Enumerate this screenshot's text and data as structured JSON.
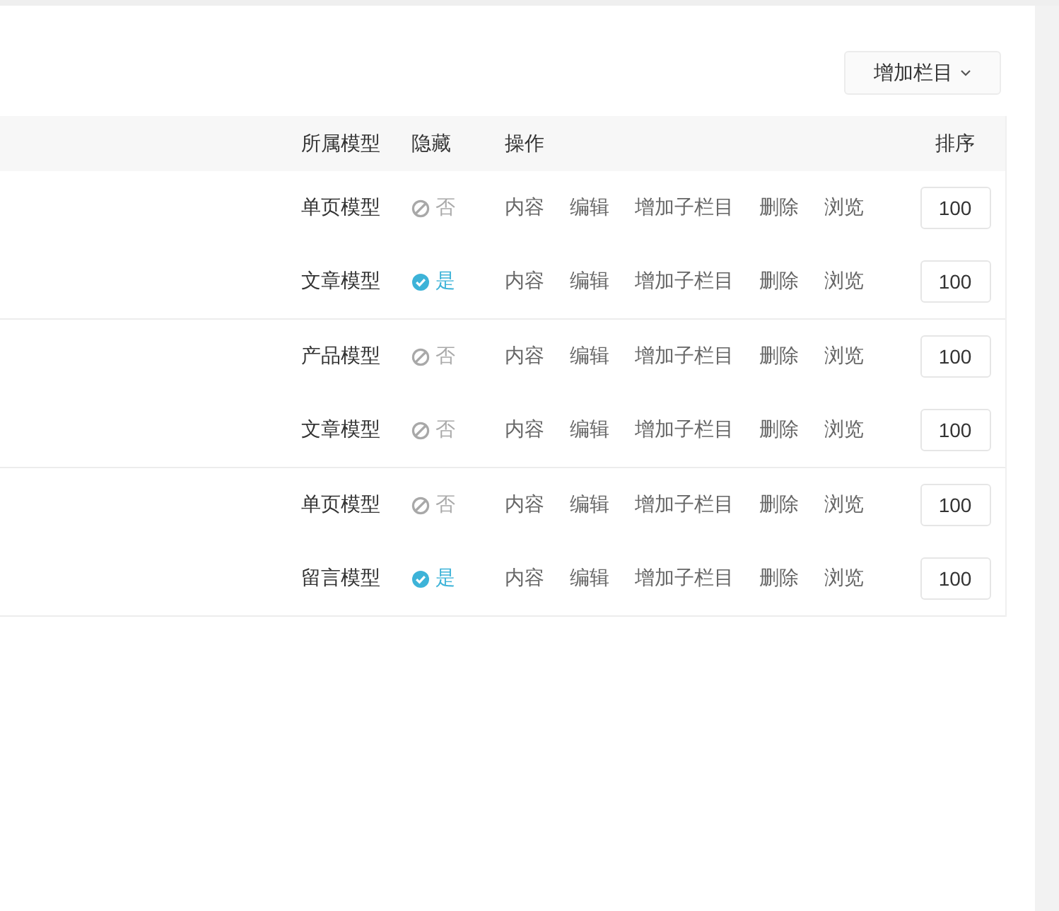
{
  "add_button": {
    "label": "增加栏目"
  },
  "table": {
    "columns": [
      "所属模型",
      "隐藏",
      "操作",
      "排序"
    ],
    "groups": [
      {
        "rows": [
          {
            "model": "单页模型",
            "hidden": false,
            "hidden_text": "否",
            "actions": [
              "内容",
              "编辑",
              "增加子栏目",
              "删除",
              "浏览"
            ],
            "sort": "100"
          },
          {
            "model": "文章模型",
            "hidden": true,
            "hidden_text": "是",
            "actions": [
              "内容",
              "编辑",
              "增加子栏目",
              "删除",
              "浏览"
            ],
            "sort": "100"
          }
        ]
      },
      {
        "rows": [
          {
            "model": "产品模型",
            "hidden": false,
            "hidden_text": "否",
            "actions": [
              "内容",
              "编辑",
              "增加子栏目",
              "删除",
              "浏览"
            ],
            "sort": "100"
          },
          {
            "model": "文章模型",
            "hidden": false,
            "hidden_text": "否",
            "actions": [
              "内容",
              "编辑",
              "增加子栏目",
              "删除",
              "浏览"
            ],
            "sort": "100"
          }
        ]
      },
      {
        "rows": [
          {
            "model": "单页模型",
            "hidden": false,
            "hidden_text": "否",
            "actions": [
              "内容",
              "编辑",
              "增加子栏目",
              "删除",
              "浏览"
            ],
            "sort": "100"
          },
          {
            "model": "留言模型",
            "hidden": true,
            "hidden_text": "是",
            "actions": [
              "内容",
              "编辑",
              "增加子栏目",
              "删除",
              "浏览"
            ],
            "sort": "100"
          }
        ]
      }
    ]
  }
}
